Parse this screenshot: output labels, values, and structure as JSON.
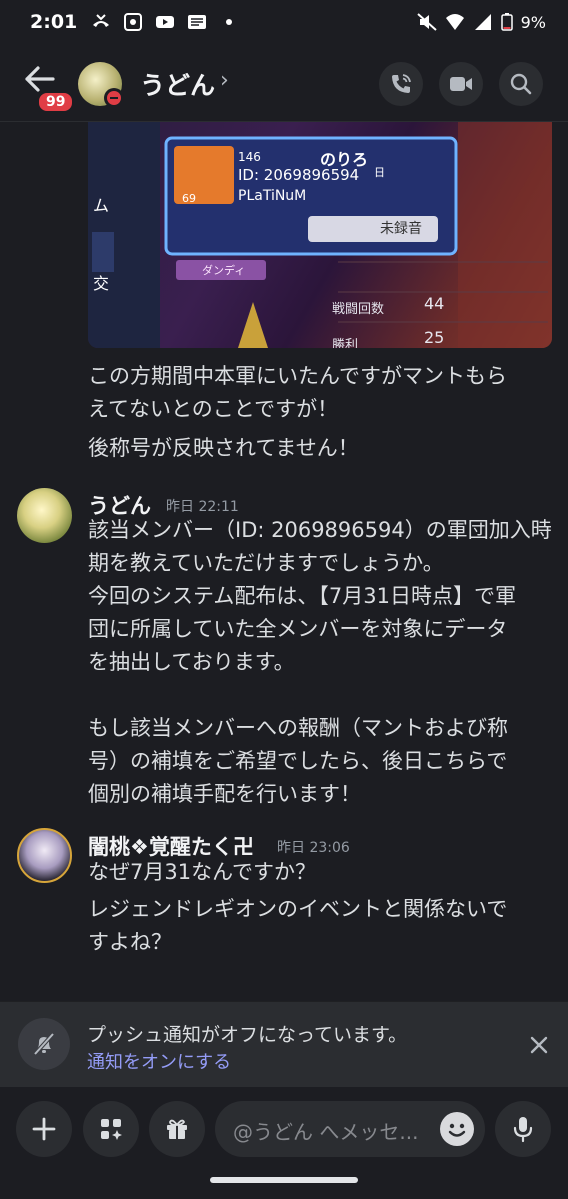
{
  "status_bar": {
    "time": "2:01",
    "battery": "9%"
  },
  "header": {
    "unread_badge": "99",
    "title": "うどん",
    "chevron": "›"
  },
  "embed": {
    "game_level": "146",
    "player_name": "のりろ",
    "player_id": "ID: 2069896594",
    "rank": "PLaTiNuM",
    "record_button": "未録音",
    "tag": "ダンディ",
    "level": "69",
    "stat_battles_label": "戦闘回数",
    "stat_battles_value": "44",
    "stat_wins_label": "勝利",
    "stat_wins_value": "25",
    "side_tab": "日",
    "side_text_1": "ム",
    "side_text_2": "交"
  },
  "messages": [
    {
      "lines": [
        "この方期間中本軍にいたんですがマントもら",
        "えてないとのことですが！",
        "後称号が反映されてません！"
      ]
    },
    {
      "author": "うどん",
      "timestamp": "昨日 22:11",
      "lines": [
        "該当メンバー（ID: 2069896594）の軍団加入時",
        "期を教えていただけますでしょうか。",
        "今回のシステム配布は、【7月31日時点】で軍",
        "団に所属していた全メンバーを対象にデータ",
        "を抽出しております。",
        "",
        "もし該当メンバーへの報酬（マントおよび称",
        "号）の補填をご希望でしたら、後日こちらで",
        "個別の補填手配を行います！"
      ]
    },
    {
      "author": "闇桃❖覚醒たく卍",
      "timestamp": "昨日 23:06",
      "lines": [
        "なぜ7月31なんですか？",
        "レジェンドレギオンのイベントと関係ないで",
        "すよね？"
      ]
    }
  ],
  "notice": {
    "text": "プッシュ通知がオフになっています。",
    "link": "通知をオンにする"
  },
  "input": {
    "placeholder": "@うどん へメッセ..."
  },
  "colors": {
    "background": "#1c1d22",
    "link": "#949cf7",
    "badge": "#e03d45"
  },
  "icons": [
    "back-arrow-icon",
    "phone-call-icon",
    "video-camera-icon",
    "search-icon",
    "bell-off-icon",
    "close-icon",
    "plus-icon",
    "apps-icon",
    "gift-icon",
    "emoji-icon",
    "microphone-icon"
  ]
}
